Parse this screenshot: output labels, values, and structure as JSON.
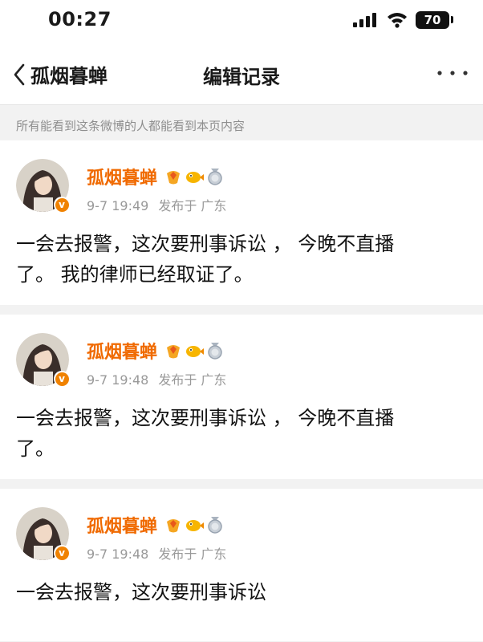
{
  "status_bar": {
    "time": "00:27",
    "battery": "70"
  },
  "nav": {
    "back_label": "孤烟暮蝉",
    "title": "编辑记录"
  },
  "notice": "所有能看到这条微博的人都能看到本页内容",
  "posts": [
    {
      "author": "孤烟暮蝉",
      "date": "9-7 19:49",
      "location": "发布于 广东",
      "lines": [
        "一会去报警，这次要刑事诉讼 ，  今晚不直播",
        "了。 我的律师已经取证了。"
      ]
    },
    {
      "author": "孤烟暮蝉",
      "date": "9-7 19:48",
      "location": "发布于 广东",
      "lines": [
        "一会去报警，这次要刑事诉讼 ，  今晚不直播",
        "了。"
      ]
    },
    {
      "author": "孤烟暮蝉",
      "date": "9-7 19:48",
      "location": "发布于 广东",
      "lines": [
        "一会去报警，这次要刑事诉讼"
      ]
    }
  ],
  "colors": {
    "accent": "#f06a00",
    "verified_badge": "#f08200",
    "meta_text": "#999999",
    "background": "#f2f2f2"
  },
  "icons": [
    "signal-icon",
    "wifi-icon",
    "battery-icon",
    "back-chevron-icon",
    "more-icon",
    "verified-icon",
    "fan-badge-icon",
    "pufferfish-icon",
    "medal-icon"
  ]
}
